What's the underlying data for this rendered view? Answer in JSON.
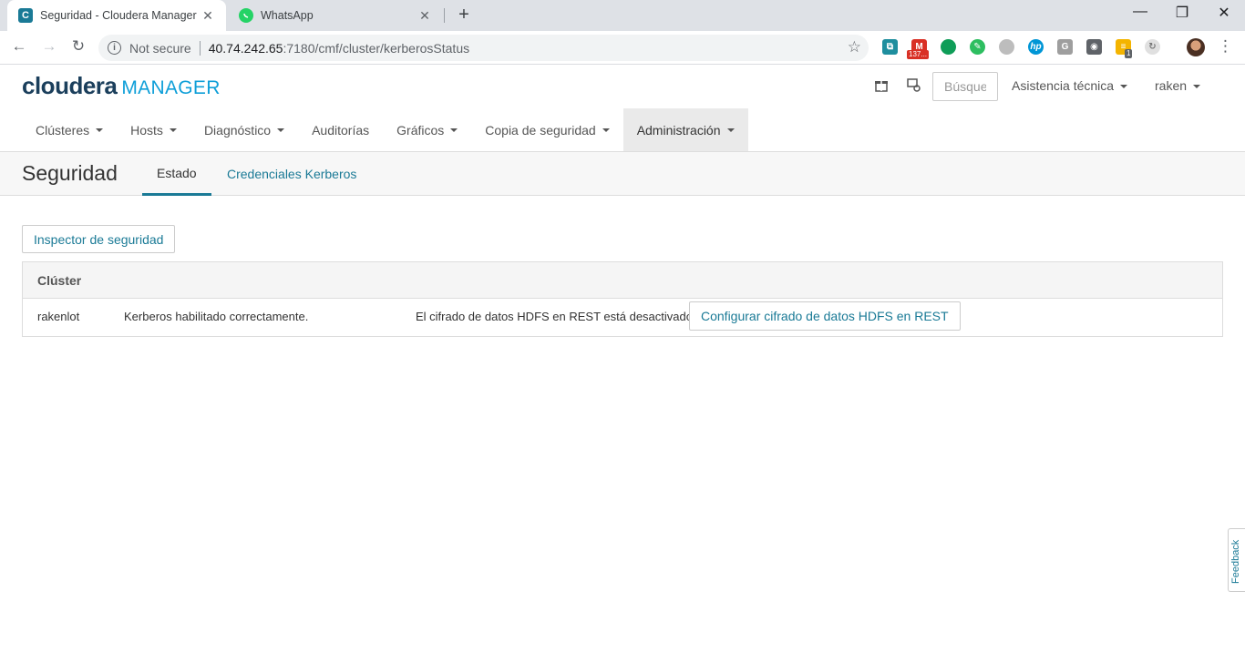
{
  "browser": {
    "tabs": [
      {
        "title": "Seguridad - Cloudera Manager",
        "favicon": "C",
        "close": "✕"
      },
      {
        "title": "WhatsApp",
        "favicon": "whatsapp-icon",
        "close": "✕"
      }
    ],
    "new_tab": "+",
    "window_controls": {
      "minimize": "—",
      "restore": "❐",
      "close": "✕"
    },
    "security_label": "Not secure",
    "url_host": "40.74.242.65",
    "url_path": ":7180/cmf/cluster/kerberosStatus",
    "gmail_badge": "137...",
    "ext_badge": "1"
  },
  "header": {
    "logo_cloudera": "cloudera",
    "logo_manager": "MANAGER",
    "search_placeholder": "Búsqueda",
    "support_menu": "Asistencia técnica",
    "user_menu": "raken"
  },
  "nav": {
    "items": [
      {
        "label": "Clústeres",
        "dropdown": true
      },
      {
        "label": "Hosts",
        "dropdown": true
      },
      {
        "label": "Diagnóstico",
        "dropdown": true
      },
      {
        "label": "Auditorías",
        "dropdown": false
      },
      {
        "label": "Gráficos",
        "dropdown": true
      },
      {
        "label": "Copia de seguridad",
        "dropdown": true
      },
      {
        "label": "Administración",
        "dropdown": true,
        "active": true
      }
    ]
  },
  "page": {
    "title": "Seguridad",
    "tabs": {
      "status": "Estado",
      "kerberos_credentials": "Credenciales Kerberos"
    }
  },
  "content": {
    "inspector_button": "Inspector de seguridad",
    "table_header": "Clúster",
    "row": {
      "cluster": "rakenlot",
      "kerberos_status": "Kerberos habilitado correctamente.",
      "hdfs_status": "El cifrado de datos HDFS en REST está desactivado",
      "config_button": "Configurar cifrado de datos HDFS en REST"
    }
  },
  "feedback": "Feedback",
  "colors": {
    "accent": "#1a7a96",
    "logo_dark": "#1b3f5c",
    "logo_blue": "#0f9fd8"
  }
}
